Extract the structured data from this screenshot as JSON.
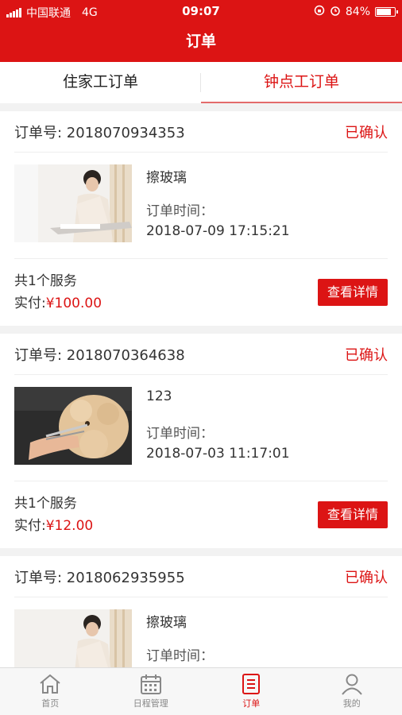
{
  "status_bar": {
    "carrier": "中国联通",
    "network": "4G",
    "time": "09:07",
    "battery": "84%",
    "battery_level": 0.84
  },
  "header": {
    "title": "订单"
  },
  "tabs": [
    {
      "label": "住家工订单",
      "active": false
    },
    {
      "label": "钟点工订单",
      "active": true
    }
  ],
  "orders": [
    {
      "order_no": "订单号: 2018070934353",
      "status": "已确认",
      "service_name": "擦玻璃",
      "time_label": "订单时间：",
      "time": "2018-07-09 17:15:21",
      "count": "共1个服务",
      "paid_label": "实付:",
      "paid_amount": "¥100.00",
      "button": "查看详情",
      "image": "window-cleaning-photo"
    },
    {
      "order_no": "订单号: 2018070364638",
      "status": "已确认",
      "service_name": "123",
      "time_label": "订单时间：",
      "time": "2018-07-03 11:17:01",
      "count": "共1个服务",
      "paid_label": "实付:",
      "paid_amount": "¥12.00",
      "button": "查看详情",
      "image": "poodle-grooming-photo"
    },
    {
      "order_no": "订单号: 2018062935955",
      "status": "已确认",
      "service_name": "擦玻璃",
      "time_label": "订单时间：",
      "image": "window-cleaning-photo"
    }
  ],
  "bottom_nav": [
    {
      "label": "首页",
      "icon": "home-icon",
      "active": false
    },
    {
      "label": "日程管理",
      "icon": "calendar-icon",
      "active": false
    },
    {
      "label": "订单",
      "icon": "order-list-icon",
      "active": true
    },
    {
      "label": "我的",
      "icon": "user-icon",
      "active": false
    }
  ],
  "colors": {
    "brand": "#dc1414",
    "background": "#f2f2f2"
  }
}
